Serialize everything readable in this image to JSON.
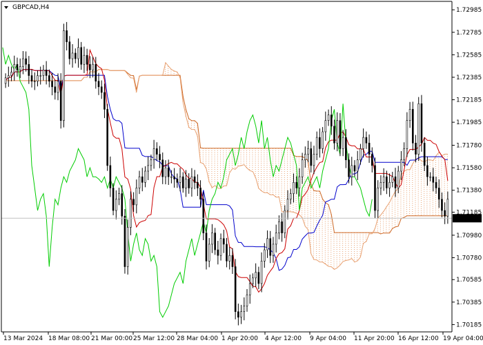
{
  "symbol": "GBPCAD,H4",
  "price_label": "1.71131",
  "colors": {
    "background": "#ffffff",
    "axis": "#000000",
    "candle": "#000000",
    "tenkan": "#cc0000",
    "kijun": "#0000cc",
    "chikou": "#00cc00",
    "kumo": "#e8a070",
    "kumo_b": "#cc6622",
    "price_line": "#c0c0c0",
    "price_label_bg": "#000000",
    "price_label_text": "#ffffff"
  },
  "chart_data": {
    "type": "candlestick",
    "title": "GBPCAD,H4",
    "ylim": [
      1.7012,
      1.7306
    ],
    "yticks": [
      "1.72985",
      "1.72785",
      "1.72585",
      "1.72385",
      "1.72185",
      "1.71985",
      "1.71780",
      "1.71580",
      "1.71380",
      "1.71185",
      "1.70980",
      "1.70780",
      "1.70585",
      "1.70385",
      "1.70185"
    ],
    "xticks": [
      "13 Mar 2024",
      "18 Mar 08:00",
      "21 Mar 00:00",
      "25 Mar 12:00",
      "28 Mar 04:00",
      "1 Apr 20:00",
      "4 Apr 12:00",
      "9 Apr 04:00",
      "11 Apr 20:00",
      "16 Apr 12:00",
      "19 Apr 04:00"
    ],
    "current_price": 1.71131,
    "close": [
      1.7238,
      1.724,
      1.7243,
      1.725,
      1.7245,
      1.7248,
      1.7255,
      1.725,
      1.724,
      1.7235,
      1.7235,
      1.724,
      1.724,
      1.7245,
      1.724,
      1.7235,
      1.723,
      1.7225,
      1.7235,
      1.72,
      1.728,
      1.727,
      1.7255,
      1.726,
      1.7255,
      1.7265,
      1.725,
      1.7258,
      1.725,
      1.7245,
      1.725,
      1.7235,
      1.723,
      1.7225,
      1.721,
      1.716,
      1.714,
      1.712,
      1.713,
      1.7135,
      1.7115,
      1.707,
      1.7105,
      1.713,
      1.7125,
      1.714,
      1.715,
      1.7145,
      1.7155,
      1.716,
      1.7165,
      1.7175,
      1.717,
      1.7165,
      1.715,
      1.7158,
      1.715,
      1.715,
      1.7148,
      1.7145,
      1.715,
      1.714,
      1.7148,
      1.714,
      1.715,
      1.7145,
      1.714,
      1.713,
      1.71,
      1.7075,
      1.709,
      1.71,
      1.7085,
      1.708,
      1.7095,
      1.709,
      1.7075,
      1.708,
      1.707,
      1.703,
      1.7025,
      1.703,
      1.7035,
      1.7045,
      1.7055,
      1.706,
      1.7065,
      1.7055,
      1.7075,
      1.7085,
      1.7095,
      1.708,
      1.709,
      1.71,
      1.711,
      1.71,
      1.712,
      1.713,
      1.7135,
      1.7145,
      1.714,
      1.715,
      1.7165,
      1.717,
      1.7175,
      1.716,
      1.717,
      1.7185,
      1.7175,
      1.719,
      1.72,
      1.7205,
      1.7195,
      1.718,
      1.72,
      1.7175,
      1.7185,
      1.7165,
      1.715,
      1.716,
      1.7155,
      1.7165,
      1.7175,
      1.7185,
      1.718,
      1.717,
      1.716,
      1.712,
      1.714,
      1.7145,
      1.715,
      1.714,
      1.7145,
      1.715,
      1.714,
      1.7155,
      1.7165,
      1.7175,
      1.72,
      1.721,
      1.718,
      1.717,
      1.7215,
      1.718,
      1.716,
      1.715,
      1.715,
      1.7145,
      1.714,
      1.713,
      1.712,
      1.7115,
      1.713
    ]
  }
}
